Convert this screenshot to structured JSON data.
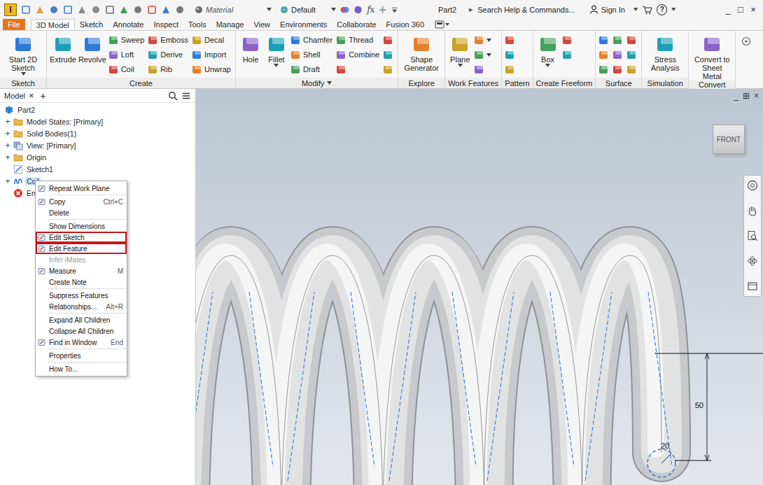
{
  "titlebar": {
    "logo": "I",
    "material": "Material",
    "appearance": "Default",
    "fx": "fx",
    "document": "Part2",
    "search_arrow": "▸",
    "search": "Search Help & Commands...",
    "sign_in": "Sign In",
    "help": "?",
    "window_controls": [
      "_",
      "□",
      "×"
    ]
  },
  "tabs": [
    {
      "label": "File",
      "kind": "application-menu",
      "selected": false
    },
    {
      "label": "3D Model",
      "kind": "tab",
      "selected": true
    },
    {
      "label": "Sketch",
      "kind": "tab",
      "selected": false
    },
    {
      "label": "Annotate",
      "kind": "tab",
      "selected": false
    },
    {
      "label": "Inspect",
      "kind": "tab",
      "selected": false
    },
    {
      "label": "Tools",
      "kind": "tab",
      "selected": false
    },
    {
      "label": "Manage",
      "kind": "tab",
      "selected": false
    },
    {
      "label": "View",
      "kind": "tab",
      "selected": false
    },
    {
      "label": "Environments",
      "kind": "tab",
      "selected": false
    },
    {
      "label": "Collaborate",
      "kind": "tab",
      "selected": false
    },
    {
      "label": "Fusion 360",
      "kind": "tab",
      "selected": false
    }
  ],
  "ribbon": {
    "groups": [
      {
        "label": "Sketch",
        "dropdown": false,
        "columns": [
          {
            "kind": "large",
            "label": "Start 2D Sketch",
            "dropdown": true
          }
        ]
      },
      {
        "label": "Create",
        "dropdown": false,
        "columns": [
          {
            "kind": "large",
            "label": "Extrude",
            "dropdown": false
          },
          {
            "kind": "large",
            "label": "Revolve",
            "dropdown": false
          },
          {
            "kind": "stack",
            "items": [
              {
                "label": "Sweep",
                "dropdown": false
              },
              {
                "label": "Loft",
                "dropdown": false
              },
              {
                "label": "Coil",
                "dropdown": false
              }
            ]
          },
          {
            "kind": "stack",
            "items": [
              {
                "label": "Emboss",
                "dropdown": false
              },
              {
                "label": "Derive",
                "dropdown": false
              },
              {
                "label": "Rib",
                "dropdown": false
              }
            ]
          },
          {
            "kind": "stack",
            "items": [
              {
                "label": "Decal",
                "dropdown": false
              },
              {
                "label": "Import",
                "dropdown": false
              },
              {
                "label": "Unwrap",
                "dropdown": false
              }
            ]
          }
        ]
      },
      {
        "label": "Modify",
        "dropdown": true,
        "columns": [
          {
            "kind": "large",
            "label": "Hole",
            "dropdown": false
          },
          {
            "kind": "large",
            "label": "Fillet",
            "dropdown": true
          },
          {
            "kind": "stack",
            "items": [
              {
                "label": "Chamfer",
                "dropdown": false
              },
              {
                "label": "Shell",
                "dropdown": false
              },
              {
                "label": "Draft",
                "dropdown": false
              }
            ]
          },
          {
            "kind": "stack",
            "items": [
              {
                "label": "Thread",
                "dropdown": false
              },
              {
                "label": "Combine",
                "dropdown": false
              },
              {
                "dropdown": false
              }
            ]
          },
          {
            "kind": "stack",
            "items": [
              {
                "dropdown": false
              },
              {
                "dropdown": false
              },
              {
                "dropdown": false
              }
            ]
          }
        ]
      },
      {
        "label": "Explore",
        "dropdown": false,
        "columns": [
          {
            "kind": "large",
            "label": "Shape Generator",
            "dropdown": false
          }
        ]
      },
      {
        "label": "Work Features",
        "dropdown": false,
        "columns": [
          {
            "kind": "large",
            "label": "Plane",
            "dropdown": true
          },
          {
            "kind": "stack",
            "items": [
              {
                "dropdown": true
              },
              {
                "dropdown": true
              },
              {
                "dropdown": false
              }
            ]
          }
        ]
      },
      {
        "label": "Pattern",
        "dropdown": false,
        "columns": [
          {
            "kind": "stack",
            "items": [
              {
                "dropdown": false
              },
              {
                "dropdown": false
              },
              {
                "dropdown": false
              }
            ]
          }
        ]
      },
      {
        "label": "Create Freeform",
        "dropdown": false,
        "columns": [
          {
            "kind": "large",
            "label": "Box",
            "dropdown": true
          },
          {
            "kind": "stack",
            "items": [
              {
                "dropdown": false
              },
              {
                "dropdown": false
              }
            ]
          }
        ]
      },
      {
        "label": "Surface",
        "dropdown": false,
        "columns": [
          {
            "kind": "stack",
            "items": [
              {
                "dropdown": false
              },
              {
                "dropdown": false
              },
              {
                "dropdown": false
              }
            ]
          },
          {
            "kind": "stack",
            "items": [
              {
                "dropdown": false
              },
              {
                "dropdown": false
              },
              {
                "dropdown": false
              }
            ]
          },
          {
            "kind": "stack",
            "items": [
              {
                "dropdown": false
              },
              {
                "dropdown": false
              },
              {
                "dropdown": false
              }
            ]
          }
        ]
      },
      {
        "label": "Simulation",
        "dropdown": false,
        "columns": [
          {
            "kind": "large",
            "label": "Stress Analysis",
            "dropdown": false
          }
        ]
      },
      {
        "label": "Convert",
        "dropdown": false,
        "columns": [
          {
            "kind": "large",
            "label": "Convert to Sheet Metal",
            "dropdown": false
          }
        ]
      }
    ]
  },
  "browser": {
    "tab": "Model",
    "close": "×",
    "add": "+",
    "tree": [
      {
        "label": "Part2",
        "depth": 0,
        "kind": "part",
        "selected": false
      },
      {
        "label": "Model States: [Primary]",
        "depth": 1,
        "kind": "folder",
        "expander": "+",
        "selected": false
      },
      {
        "label": "Solid Bodies(1)",
        "depth": 1,
        "kind": "folder",
        "expander": "+",
        "selected": false
      },
      {
        "label": "View: [Primary]",
        "depth": 1,
        "kind": "view",
        "expander": "+",
        "selected": false
      },
      {
        "label": "Origin",
        "depth": 1,
        "kind": "folder",
        "expander": "+",
        "selected": false
      },
      {
        "label": "Sketch1",
        "depth": 1,
        "kind": "sketch",
        "selected": false
      },
      {
        "label": "Coil",
        "depth": 1,
        "kind": "coil",
        "expander": "+",
        "selected": true
      },
      {
        "label": "End",
        "depth": 1,
        "kind": "end",
        "selected": false
      }
    ]
  },
  "context_menu": {
    "groups": [
      [
        {
          "label": "Repeat Work Plane",
          "has_icon": true,
          "disabled": false,
          "highlighted": false
        }
      ],
      [
        {
          "label": "Copy",
          "shortcut": "Ctrl+C",
          "has_icon": true,
          "disabled": false,
          "highlighted": false
        },
        {
          "label": "Delete",
          "has_icon": false,
          "disabled": false,
          "highlighted": false
        }
      ],
      [
        {
          "label": "Show Dimensions",
          "has_icon": false,
          "disabled": false,
          "highlighted": false
        },
        {
          "label": "Edit Sketch",
          "has_icon": true,
          "disabled": false,
          "highlighted": true
        },
        {
          "label": "Edit Feature",
          "has_icon": true,
          "disabled": false,
          "highlighted": true
        },
        {
          "label": "Infer iMates",
          "has_icon": false,
          "disabled": true,
          "highlighted": false
        },
        {
          "label": "Measure",
          "shortcut": "M",
          "has_icon": true,
          "disabled": false,
          "highlighted": false
        },
        {
          "label": "Create Note",
          "has_icon": false,
          "disabled": false,
          "highlighted": false
        }
      ],
      [
        {
          "label": "Suppress Features",
          "has_icon": false,
          "disabled": false,
          "highlighted": false
        },
        {
          "label": "Relationships...",
          "shortcut": "Alt+R",
          "has_icon": false,
          "disabled": false,
          "highlighted": false
        }
      ],
      [
        {
          "label": "Expand All Children",
          "has_icon": false,
          "disabled": false,
          "highlighted": false
        },
        {
          "label": "Collapse All Children",
          "has_icon": false,
          "disabled": false,
          "highlighted": false
        },
        {
          "label": "Find in Window",
          "shortcut": "End",
          "has_icon": true,
          "disabled": false,
          "highlighted": false
        }
      ],
      [
        {
          "label": "Properties",
          "has_icon": false,
          "disabled": false,
          "highlighted": false
        }
      ],
      [
        {
          "label": "How To...",
          "has_icon": false,
          "disabled": false,
          "highlighted": false
        }
      ]
    ]
  },
  "viewport": {
    "viewcube": "FRONT",
    "dimensions": [
      {
        "label": "50"
      },
      {
        "label": "20"
      }
    ],
    "window_controls": [
      "_",
      "⊞",
      "×"
    ]
  }
}
